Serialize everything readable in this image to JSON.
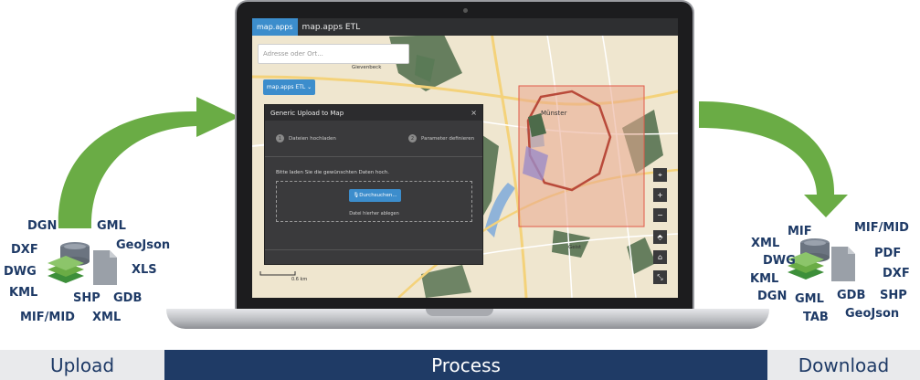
{
  "stages": {
    "upload": "Upload",
    "process": "Process",
    "download": "Download"
  },
  "upload_formats": [
    "DGN",
    "GML",
    "DXF",
    "GeoJson",
    "DWG",
    "XLS",
    "KML",
    "SHP",
    "GDB",
    "MIF/MID",
    "XML"
  ],
  "download_formats": [
    "MIF",
    "MIF/MID",
    "XML",
    "PDF",
    "DWG",
    "DXF",
    "KML",
    "DGN",
    "GML",
    "GDB",
    "SHP",
    "TAB",
    "GeoJson"
  ],
  "app": {
    "brand": "map.apps",
    "name": "map.apps ETL",
    "address_placeholder": "Adresse oder Ort...",
    "etl_button": "map.apps ETL ⌄",
    "dialog": {
      "title": "Generic Upload to Map",
      "close": "×",
      "step1_num": "1",
      "step1_label": "Dateien hochladen",
      "step2_num": "2",
      "step2_label": "Parameter definieren",
      "instruction": "Bitte laden Sie die gewünschten Daten hoch.",
      "browse_button": "🎙Durchsuchen...",
      "drop_hint": "Datei hierher ablegen"
    },
    "map": {
      "places": {
        "muenster": "Münster",
        "gievenbeck": "Gievenbeck",
        "geist": "Geist"
      },
      "scale": "0.6 km",
      "controls": [
        "⌖",
        "+",
        "−",
        "⬘",
        "⌂",
        "⤡"
      ]
    }
  },
  "colors": {
    "arrow": "#6aac45",
    "process_bar": "#1f3b66",
    "side_bar": "#e9eaec",
    "label_text": "#1e3a66",
    "accent": "#3c8dcc",
    "selection": "#e05a4a"
  },
  "icons": [
    "database-icon",
    "layers-icon",
    "file-icon"
  ]
}
